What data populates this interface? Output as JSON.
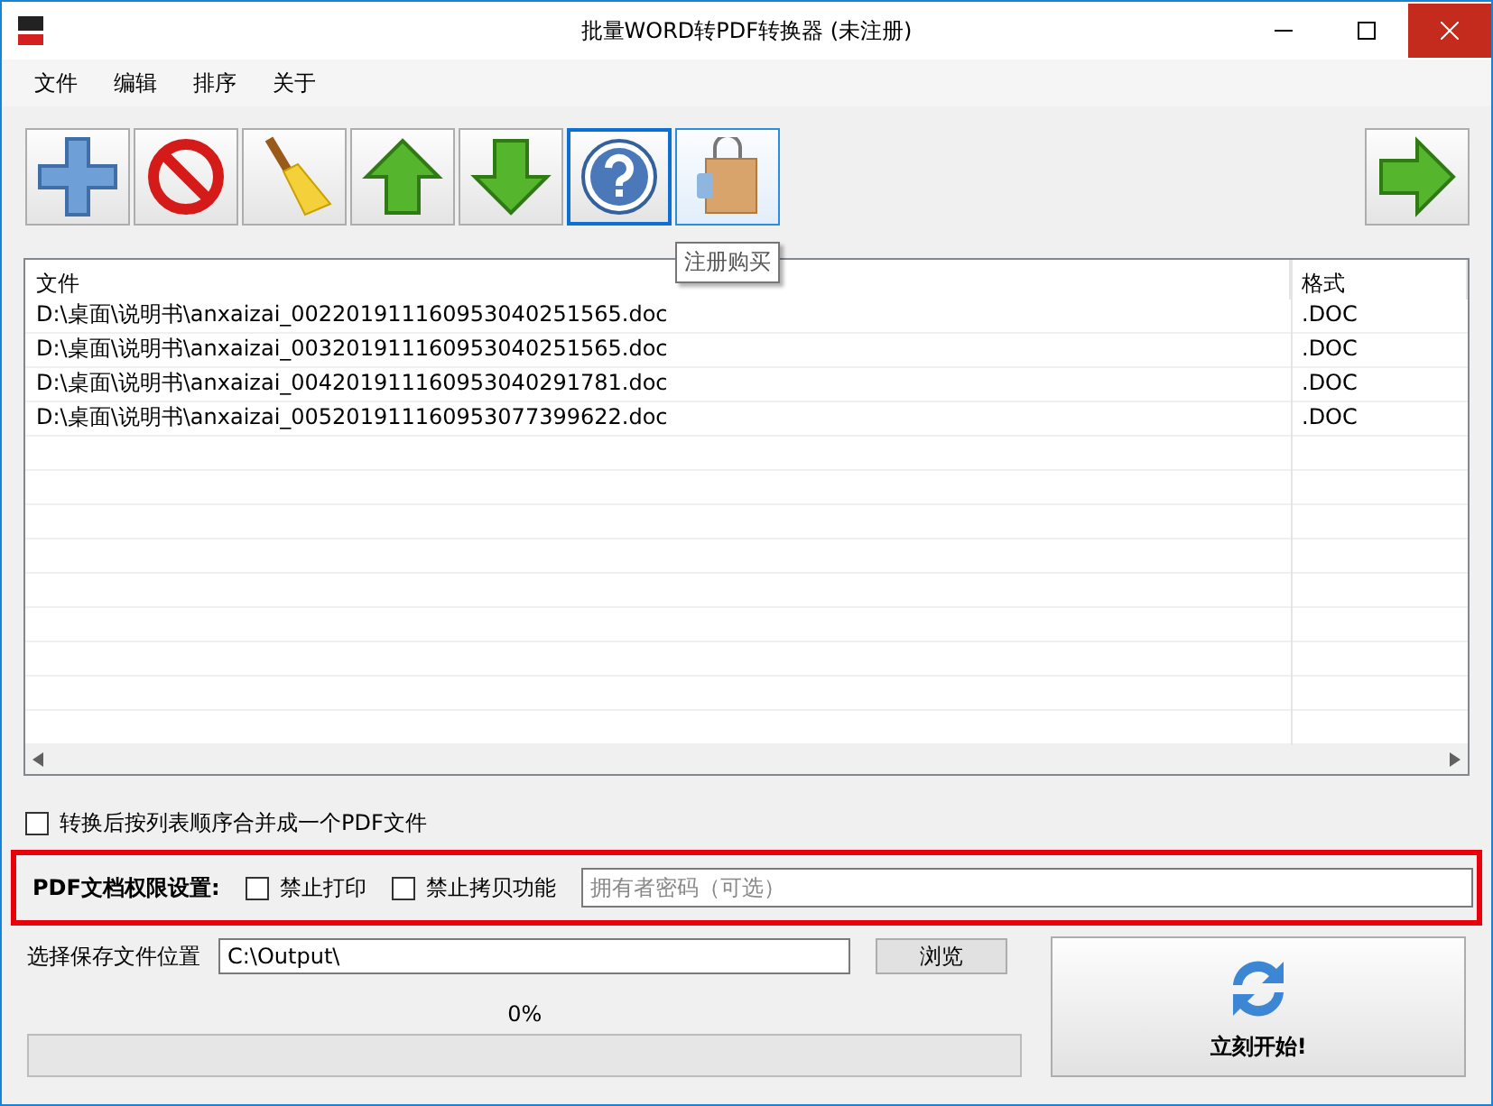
{
  "window": {
    "title": "批量WORD转PDF转换器 (未注册)"
  },
  "menu": [
    "文件",
    "编辑",
    "排序",
    "关于"
  ],
  "toolbar": [
    {
      "kind": "add",
      "focused": false,
      "hovered": false
    },
    {
      "kind": "remove",
      "focused": false,
      "hovered": false
    },
    {
      "kind": "clear",
      "focused": false,
      "hovered": false
    },
    {
      "kind": "up",
      "focused": false,
      "hovered": false
    },
    {
      "kind": "down",
      "focused": false,
      "hovered": false
    },
    {
      "kind": "help",
      "focused": true,
      "hovered": false
    },
    {
      "kind": "buy",
      "focused": false,
      "hovered": true
    }
  ],
  "tooltip": "注册购买",
  "table": {
    "columns": [
      "文件",
      "格式"
    ],
    "rows": [
      [
        "D:\\桌面\\说明书\\anxaizai_002201911160953040251565.doc",
        ".DOC"
      ],
      [
        "D:\\桌面\\说明书\\anxaizai_003201911160953040251565.doc",
        ".DOC"
      ],
      [
        "D:\\桌面\\说明书\\anxaizai_004201911160953040291781.doc",
        ".DOC"
      ],
      [
        "D:\\桌面\\说明书\\anxaizai_005201911160953077399622.doc",
        ".DOC"
      ]
    ]
  },
  "merge": {
    "label": "转换后按列表顺序合并成一个PDF文件",
    "checked": false
  },
  "permissions": {
    "label": "PDF文档权限设置:",
    "options": [
      {
        "label": "禁止打印",
        "checked": false
      },
      {
        "label": "禁止拷贝功能",
        "checked": false
      }
    ],
    "placeholder": "拥有者密码（可选）"
  },
  "output": {
    "label": "选择保存文件位置",
    "value": "C:\\Output\\",
    "browse": "浏览"
  },
  "progress": {
    "text": "0%",
    "level": 0
  },
  "start": {
    "label": "立刻开始!"
  }
}
